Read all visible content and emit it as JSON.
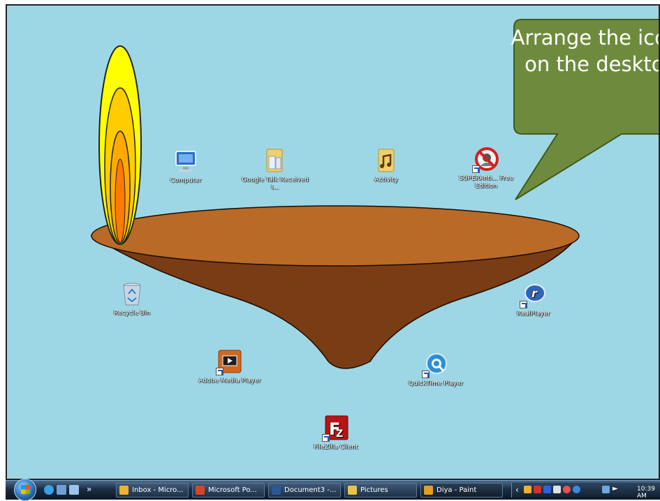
{
  "callout": {
    "text": "Arrange the icons on the desktop",
    "color": "#6e8b3d"
  },
  "diya": {
    "bowl_top_color": "#b96a26",
    "bowl_body_color": "#7a3c14",
    "flame_colors": [
      "#ffff00",
      "#ffcc00",
      "#ffaa00",
      "#ff7a00"
    ]
  },
  "desktop": {
    "background": "#9dd7e6",
    "icons": [
      {
        "label": "Computer",
        "icon": "computer-icon",
        "shortcut": false
      },
      {
        "label": "Google Talk Received I...",
        "icon": "folder-icon",
        "shortcut": false
      },
      {
        "label": "Activity",
        "icon": "music-folder-icon",
        "shortcut": false
      },
      {
        "label": "SUPERAnti... Free Edition",
        "icon": "superantispyware-icon",
        "shortcut": true
      },
      {
        "label": "Recycle Bin",
        "icon": "recycle-bin-icon",
        "shortcut": false
      },
      {
        "label": "RealPlayer",
        "icon": "realplayer-icon",
        "shortcut": true
      },
      {
        "label": "Adobe Media Player",
        "icon": "adobe-media-player-icon",
        "shortcut": true
      },
      {
        "label": "QuickTime Player",
        "icon": "quicktime-icon",
        "shortcut": true
      },
      {
        "label": "FileZilla Client",
        "icon": "filezilla-icon",
        "shortcut": true
      }
    ]
  },
  "taskbar": {
    "overflow_chevron": "»",
    "tasks": [
      {
        "label": "Inbox - Micro...",
        "icon": "outlook-icon",
        "color": "#f0b030"
      },
      {
        "label": "Microsoft Po...",
        "icon": "powerpoint-icon",
        "color": "#d24726"
      },
      {
        "label": "Document3 -...",
        "icon": "word-icon",
        "color": "#2b5797"
      },
      {
        "label": "Pictures",
        "icon": "folder-icon",
        "color": "#e8c34a"
      },
      {
        "label": "Diya - Paint",
        "icon": "paint-icon",
        "color": "#e0a020"
      }
    ],
    "tray_chevron": "‹",
    "clock": "10:39 AM"
  }
}
